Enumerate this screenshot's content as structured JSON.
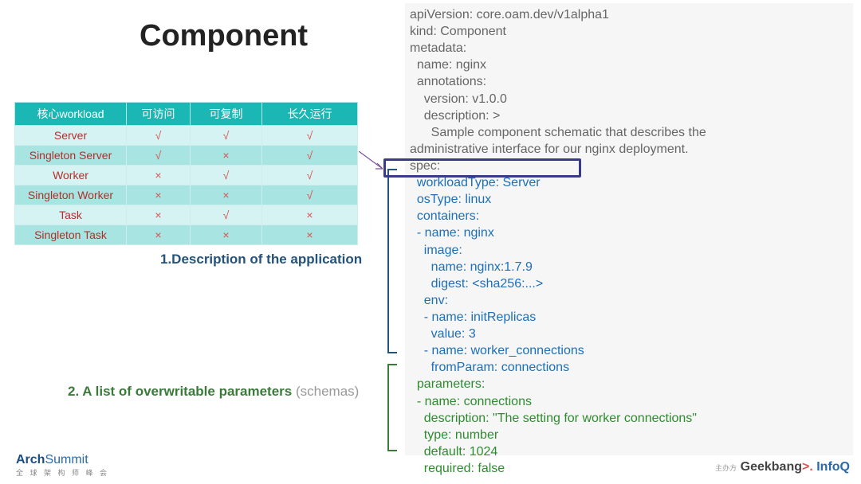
{
  "title": "Component",
  "table": {
    "headers": [
      "核心workload",
      "可访问",
      "可复制",
      "长久运行"
    ],
    "rows": [
      {
        "name": "Server",
        "v": [
          "√",
          "√",
          "√"
        ]
      },
      {
        "name": "Singleton Server",
        "v": [
          "√",
          "×",
          "√"
        ]
      },
      {
        "name": "Worker",
        "v": [
          "×",
          "√",
          "√"
        ]
      },
      {
        "name": "Singleton Worker",
        "v": [
          "×",
          "×",
          "√"
        ]
      },
      {
        "name": "Task",
        "v": [
          "×",
          "√",
          "×"
        ]
      },
      {
        "name": "Singleton Task",
        "v": [
          "×",
          "×",
          "×"
        ]
      }
    ]
  },
  "labels": {
    "desc": "1.Description of the application",
    "params_bold": "2. A list of overwritable parameters ",
    "params_paren": "(schemas)"
  },
  "code": {
    "gray_top": "apiVersion: core.oam.dev/v1alpha1\nkind: Component\nmetadata:\n  name: nginx\n  annotations:\n    version: v1.0.0\n    description: >\n      Sample component schematic that describes the\nadministrative interface for our nginx deployment.\nspec:",
    "highlight_line": "  workloadType: Server",
    "blue_block": "  osType: linux\n  containers:\n  - name: nginx\n    image:\n      name: nginx:1.7.9\n      digest: <sha256:...>\n    env:\n    - name: initReplicas\n      value: 3\n    - name: worker_connections\n      fromParam: connections",
    "green_block": "  parameters:\n  - name: connections\n    description: \"The setting for worker connections\"\n    type: number\n    default: 1024\n    required: false"
  },
  "footer": {
    "left_a": "Arch",
    "left_b": "Summit",
    "left_sub": "全 球 架 构 师 峰 会",
    "right_small": "主办方",
    "right_geek": "Geekbang",
    "right_gt": ">.",
    "right_infoq": "InfoQ"
  }
}
